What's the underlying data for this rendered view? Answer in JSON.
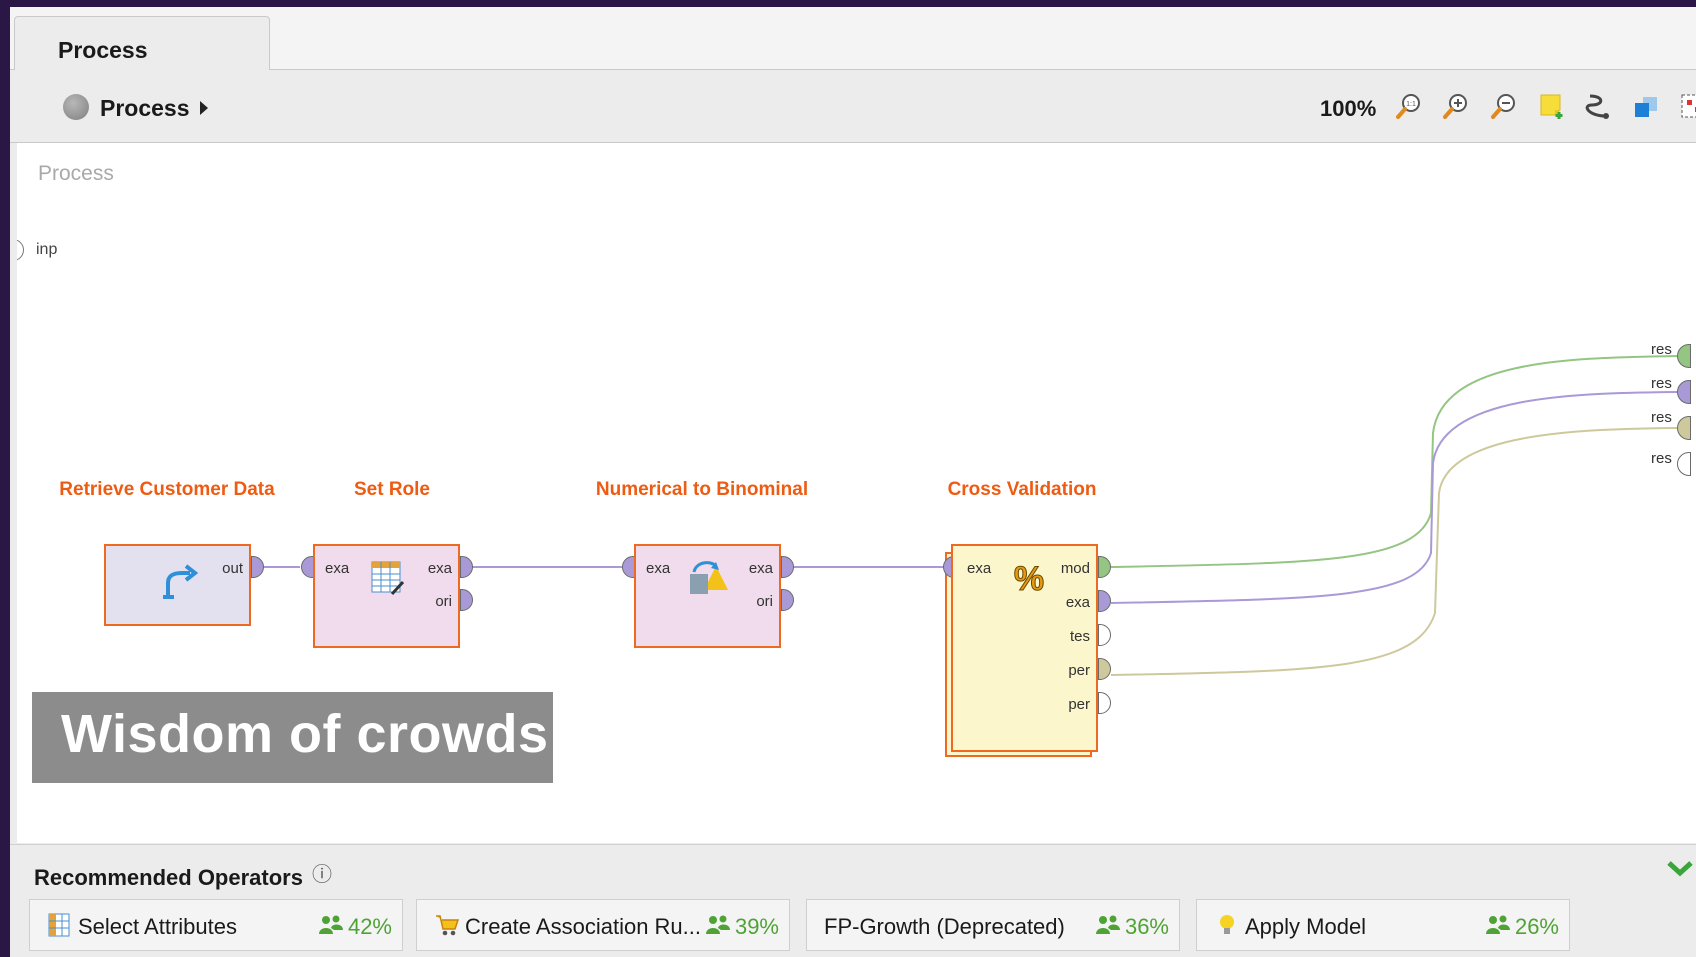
{
  "tab": {
    "label": "Process"
  },
  "toolbar": {
    "breadcrumb_label": "Process",
    "zoom_level": "100%",
    "icons": [
      "zoom-reset-icon",
      "zoom-in-icon",
      "zoom-out-icon",
      "add-note-icon",
      "auto-wire-icon",
      "layers-icon",
      "arrange-icon"
    ]
  },
  "canvas": {
    "label": "Process",
    "input_port": "inp",
    "operators": [
      {
        "title": "Retrieve Customer Data",
        "ports_out": [
          "out"
        ],
        "icon": "retrieve-arrow-icon",
        "color": "#e3e1f0"
      },
      {
        "title": "Set Role",
        "ports_in": [
          "exa"
        ],
        "ports_out": [
          "exa",
          "ori"
        ],
        "icon": "table-edit-icon",
        "color": "#f1dced"
      },
      {
        "title": "Numerical to Binominal",
        "ports_in": [
          "exa"
        ],
        "ports_out": [
          "exa",
          "ori"
        ],
        "icon": "convert-shapes-icon",
        "color": "#f1dced"
      },
      {
        "title": "Cross Validation",
        "ports_in": [
          "exa"
        ],
        "ports_out": [
          "mod",
          "exa",
          "tes",
          "per",
          "per"
        ],
        "icon": "percent-icon",
        "color": "#fcf6cc"
      }
    ],
    "result_ports": [
      "res",
      "res",
      "res",
      "res"
    ],
    "overlay_text": "Wisdom of crowds"
  },
  "recommended": {
    "title": "Recommended Operators",
    "info_icon": "ⓘ",
    "items": [
      {
        "name": "Select Attributes",
        "percent": "42%",
        "icon": "select-attributes-icon"
      },
      {
        "name": "Create Association Ru...",
        "percent": "39%",
        "icon": "cart-icon"
      },
      {
        "name": "FP-Growth (Deprecated)",
        "percent": "36%",
        "icon": ""
      },
      {
        "name": "Apply Model",
        "percent": "26%",
        "icon": "lightbulb-icon"
      }
    ]
  },
  "colors": {
    "accent_orange": "#ef6a21",
    "connection_purple": "#a99ad7",
    "connection_green": "#95c583",
    "connection_olive": "#cdc99c",
    "percent_green": "#4fa336"
  }
}
